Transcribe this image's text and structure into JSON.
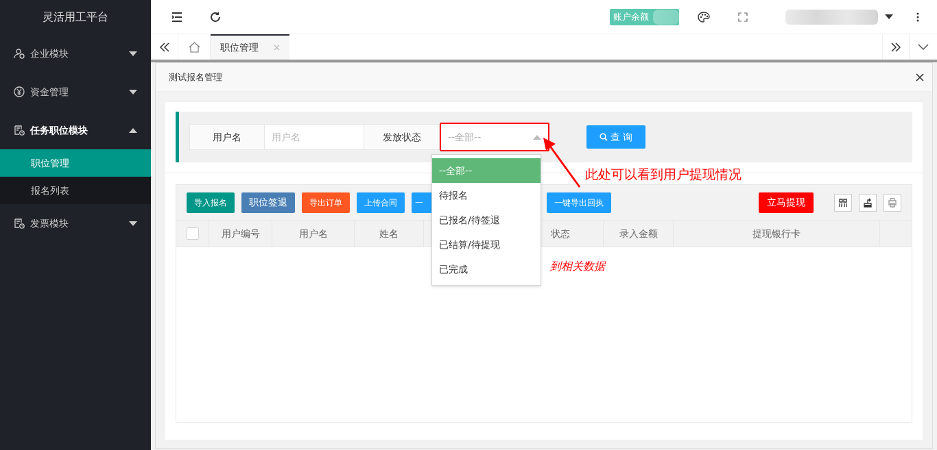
{
  "sidebar": {
    "title": "灵活用工平台",
    "items": [
      {
        "label": "企业模块",
        "expanded": false
      },
      {
        "label": "资金管理",
        "expanded": false
      },
      {
        "label": "任务职位模块",
        "expanded": true,
        "children": [
          {
            "label": "职位管理",
            "selected": true
          },
          {
            "label": "报名列表",
            "selected": false
          }
        ]
      },
      {
        "label": "发票模块",
        "expanded": false
      }
    ]
  },
  "header": {
    "balance_label": "账户余额"
  },
  "tabs": [
    {
      "label": "职位管理",
      "selected": true
    }
  ],
  "panel": {
    "title": "测试报名管理"
  },
  "filters": {
    "username_label": "用户名",
    "username_placeholder": "用户名",
    "status_label": "发放状态",
    "status_value": "--全部--",
    "search_button": "查 询"
  },
  "dropdown": {
    "options": [
      {
        "label": "--全部--",
        "selected": true
      },
      {
        "label": "待报名",
        "selected": false
      },
      {
        "label": "已报名/待签退",
        "selected": false
      },
      {
        "label": "已结算/待提现",
        "selected": false
      },
      {
        "label": "已完成",
        "selected": false
      }
    ]
  },
  "toolbar": {
    "buttons": [
      {
        "label": "导入报名",
        "color": "#009688"
      },
      {
        "label": "职位签退",
        "color": "#4a7fb5"
      },
      {
        "label": "导出订单",
        "color": "#ff5722"
      },
      {
        "label": "上传合同",
        "color": "#1e9fff"
      },
      {
        "label": "一",
        "color": "#1e9fff"
      },
      {
        "label": "一键导出回执",
        "color": "#1e9fff"
      }
    ],
    "withdraw_button": "立马提现"
  },
  "table": {
    "header_checked": false,
    "columns": [
      "用户编号",
      "用户名",
      "姓名",
      "状态",
      "录入金额",
      "提现银行卡"
    ],
    "empty_message": "到相关数据"
  },
  "annotation": {
    "text": "此处可以看到用户提现情况"
  }
}
